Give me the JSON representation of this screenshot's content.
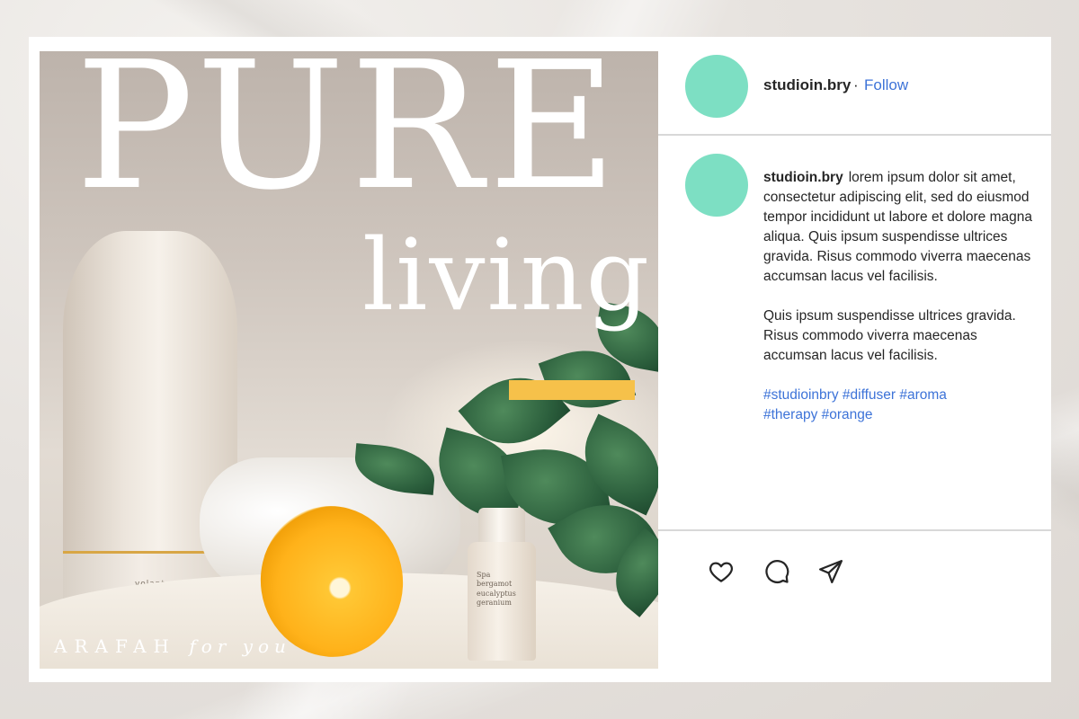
{
  "colors": {
    "avatar": "#7ddfc3",
    "accent_bar": "#f6c14a",
    "link": "#3d73d8"
  },
  "post": {
    "image": {
      "title_line1": "PURE",
      "title_line2": "living",
      "footer_brand": "ARAFAH",
      "footer_tagline": "for you",
      "diffuser_brand": "volant",
      "bottle_label": "Spa\nbergamot\neucalyptus\ngeranium"
    },
    "header": {
      "username": "studioin.bry",
      "separator": "·",
      "follow_label": "Follow"
    },
    "caption": {
      "username": "studioin.bry",
      "paragraph1": "lorem ipsum dolor sit amet, consectetur adipiscing elit, sed do eiusmod tempor incididunt ut labore et dolore magna aliqua. Quis ipsum suspendisse ultrices gravida. Risus commodo viverra maecenas accumsan lacus vel facilisis.",
      "paragraph2": "Quis ipsum suspendisse ultrices gravida. Risus commodo viverra maecenas accumsan lacus vel facilisis.",
      "hashtags": [
        "#studioinbry",
        "#diffuser",
        "#aroma",
        "#therapy",
        "#orange"
      ]
    },
    "actions": {
      "like_icon": "heart-icon",
      "comment_icon": "comment-icon",
      "share_icon": "paper-plane-icon"
    }
  }
}
